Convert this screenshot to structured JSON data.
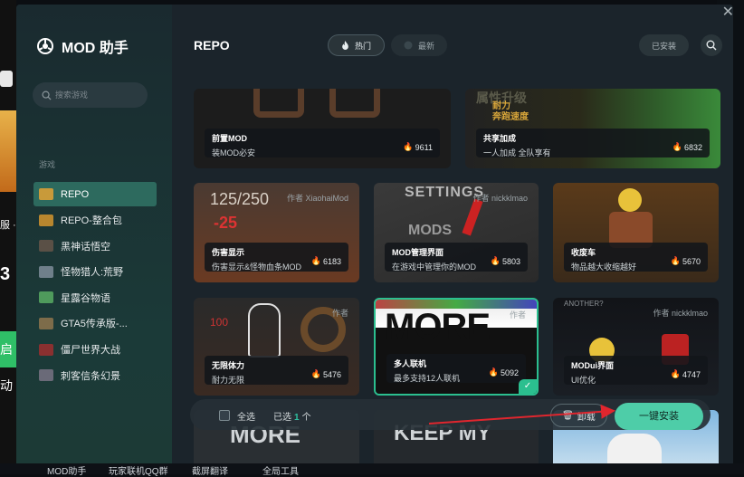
{
  "app": {
    "name": "MOD 助手"
  },
  "search": {
    "placeholder": "搜索游戏"
  },
  "sidebar": {
    "section_label": "游戏",
    "games": [
      {
        "label": "REPO",
        "color": "#c89a3a",
        "active": true
      },
      {
        "label": "REPO-整合包",
        "color": "#b8862e",
        "active": false
      },
      {
        "label": "黑神话悟空",
        "color": "#5a5046",
        "active": false
      },
      {
        "label": "怪物猎人:荒野",
        "color": "#6f7f8a",
        "active": false
      },
      {
        "label": "星露谷物语",
        "color": "#4f9a5c",
        "active": false
      },
      {
        "label": "GTA5传承版-...",
        "color": "#7d6c4a",
        "active": false
      },
      {
        "label": "僵尸世界大战",
        "color": "#8a3030",
        "active": false
      },
      {
        "label": "刺客信条幻景",
        "color": "#6a6a78",
        "active": false
      }
    ]
  },
  "header": {
    "title": "REPO",
    "tabs": [
      {
        "label": "热门"
      },
      {
        "label": "最新"
      }
    ],
    "installed_label": "已安装"
  },
  "cards": [
    {
      "name": "前置MOD",
      "desc": "装MOD必安",
      "count": "9611",
      "author": ""
    },
    {
      "name": "共享加成",
      "desc": "一人加成 全队享有",
      "count": "6832",
      "author": ""
    },
    {
      "name": "伤害显示",
      "desc": "伤害显示&怪物血条MOD",
      "count": "6183",
      "author": "作者 XiaohaiMod"
    },
    {
      "name": "MOD管理界面",
      "desc": "在游戏中管理你的MOD",
      "count": "5803",
      "author": "作者 nickklmao"
    },
    {
      "name": "收废车",
      "desc": "物品越大收缩越好",
      "count": "5670",
      "author": ""
    },
    {
      "name": "无限体力",
      "desc": "耐力无限",
      "count": "5476",
      "author": "作者"
    },
    {
      "name": "多人联机",
      "desc": "最多支持12人联机",
      "count": "5092",
      "author": "作者"
    },
    {
      "name": "MODui界面",
      "desc": "UI优化",
      "count": "4747",
      "author": "作者 nickklmao"
    }
  ],
  "footer": {
    "select_all": "全选",
    "selected_prefix": "已选",
    "selected_count": "1",
    "selected_suffix": "个",
    "uninstall": "卸载",
    "install_all": "一键安装"
  },
  "background_left": {
    "t1": "服 ·",
    "t2": "3",
    "t3": "启动"
  },
  "background_bottom": {
    "i1": "MOD助手",
    "i2": "玩家联机QQ群",
    "i3": "截屏翻译",
    "i4": "全局工具"
  },
  "colors": {
    "accent": "#4ecda8",
    "active_item": "#2d6a5e",
    "window_bg": "#1b242b"
  }
}
